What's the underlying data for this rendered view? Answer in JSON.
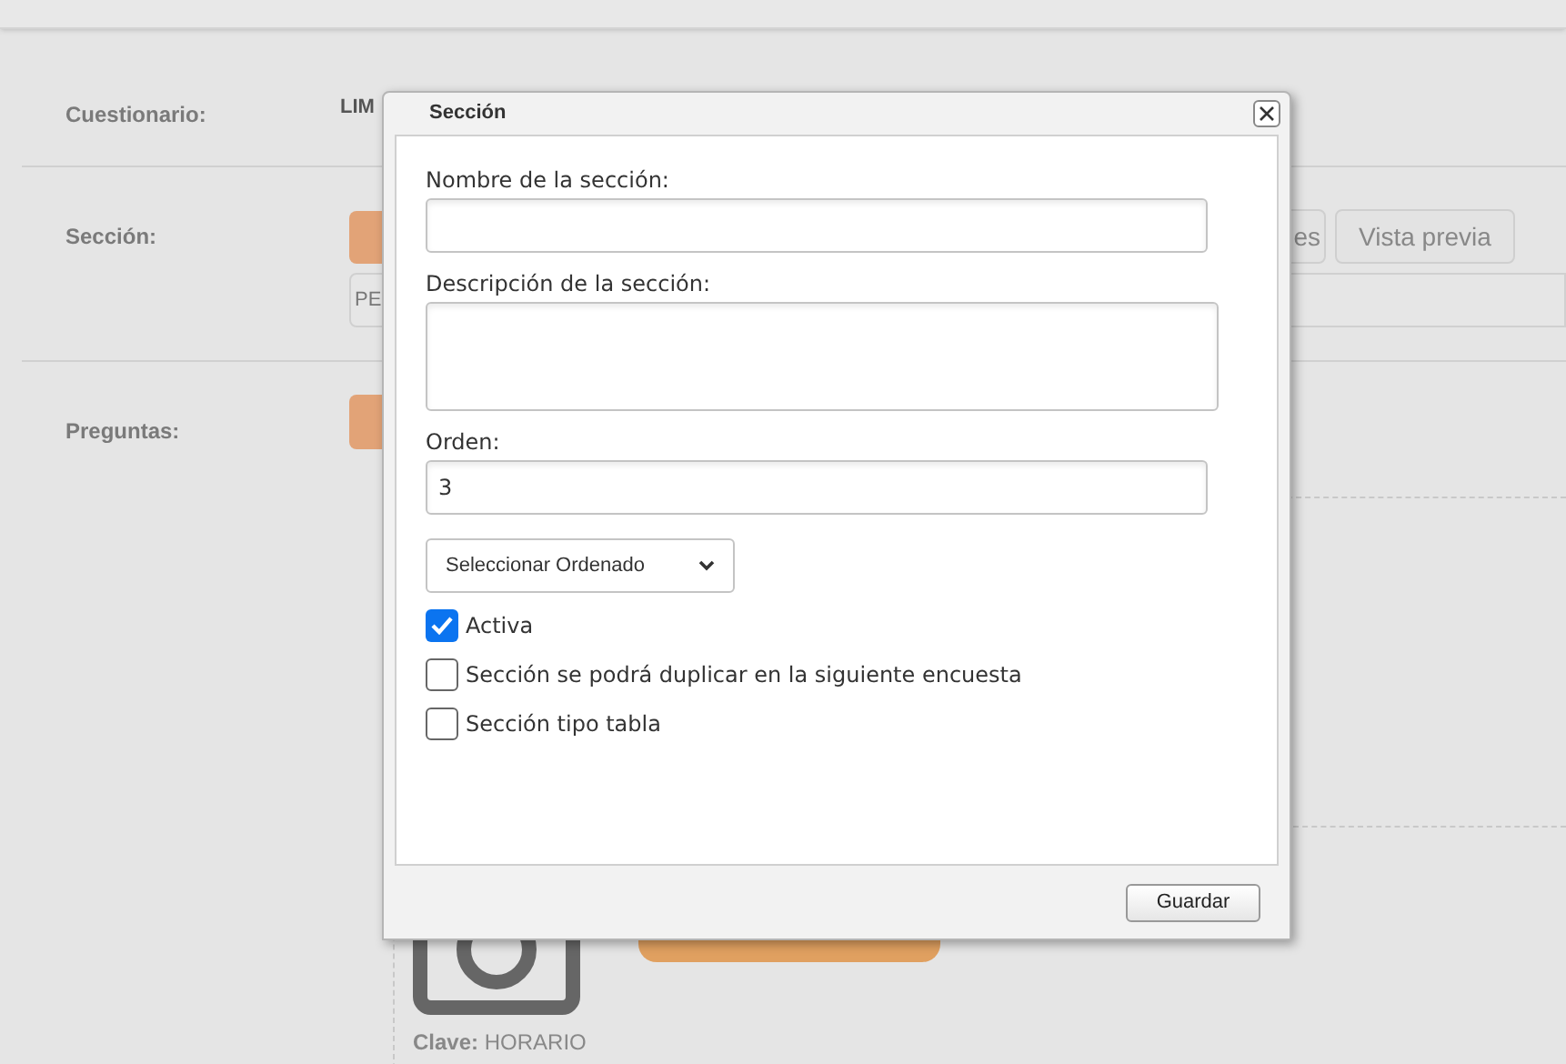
{
  "background": {
    "questionnaire": {
      "label": "Cuestionario:",
      "value": "LIM"
    },
    "section": {
      "label": "Sección:",
      "buttons": [
        "es",
        "Vista previa"
      ],
      "field_value": "PE"
    },
    "questions": {
      "label": "Preguntas:",
      "key": "**Clave:** HORARIO"
    }
  },
  "dialog": {
    "title": "Sección",
    "fields": [
      {
        "kind": "input",
        "label": "Nombre de la sección:"
      },
      {
        "kind": "textarea",
        "label": "Descripción de la sección:"
      },
      {
        "kind": "input",
        "label": "Orden:",
        "value": "3"
      }
    ],
    "select": {
      "value": "Seleccionar Ordenado"
    },
    "checkboxes": [
      {
        "label": "Activa",
        "checked": true
      },
      {
        "label": "Sección se podrá duplicar en la siguiente encuesta",
        "checked": false
      },
      {
        "label": "Sección tipo tabla",
        "checked": false
      }
    ],
    "buttons": [
      "Guardar"
    ]
  }
}
